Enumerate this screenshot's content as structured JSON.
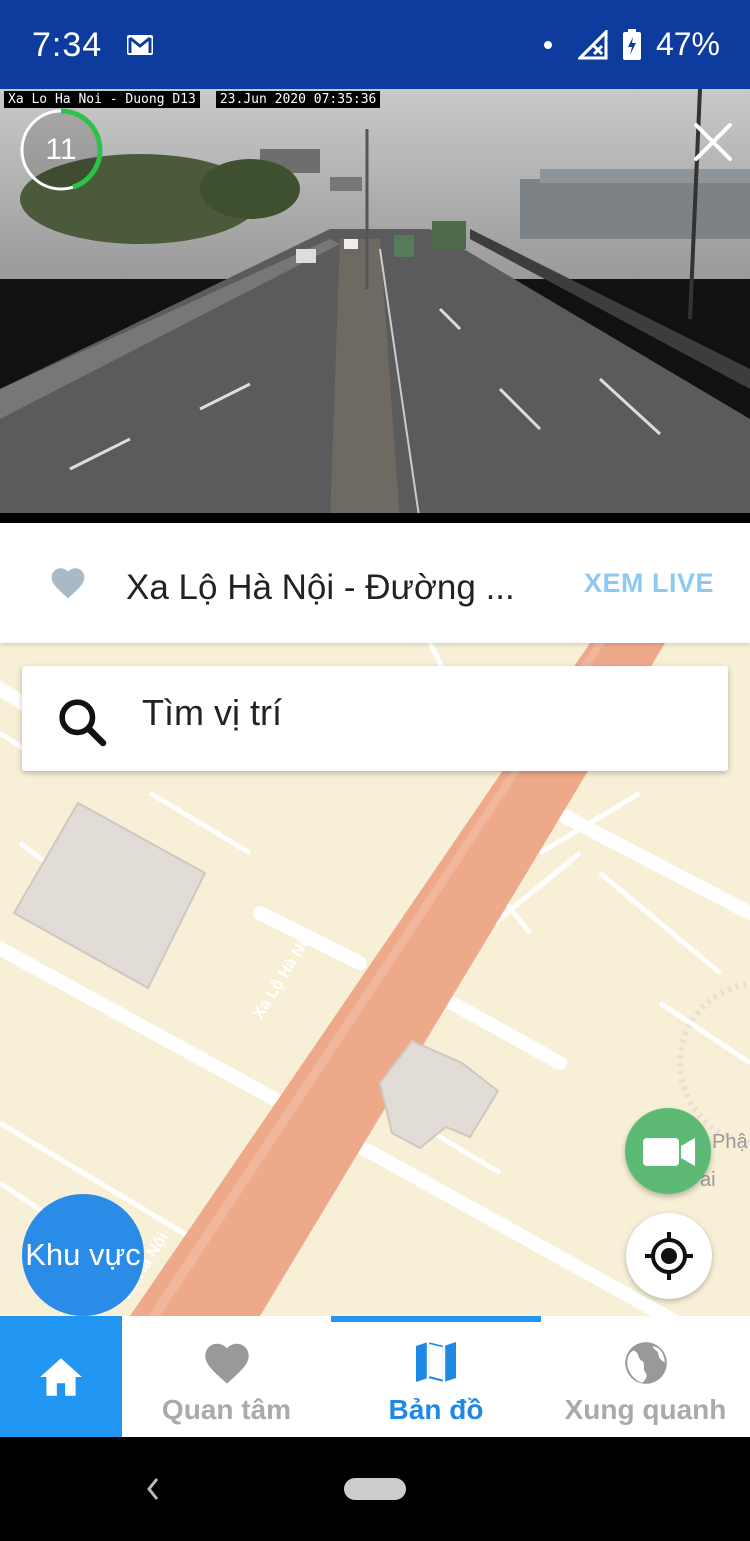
{
  "status_bar": {
    "time": "7:34",
    "battery": "47%",
    "icons": [
      "gmail-icon",
      "dot-icon",
      "signal-off-icon",
      "battery-charging-icon"
    ]
  },
  "camera": {
    "location_tag": "Xa Lo Ha Noi - Duong D13",
    "timestamp_tag": "23.Jun 2020  07:35:36",
    "countdown": "11",
    "countdown_progress": 0.45,
    "close_icon": "close-icon"
  },
  "info": {
    "title": "Xa Lộ Hà Nội - Đường ...",
    "action": "XEM LIVE",
    "favorite_icon": "heart-icon"
  },
  "search": {
    "placeholder": "Tìm vị trí",
    "icon": "search-icon"
  },
  "map": {
    "road_label": "Xa Lộ Hà Nội",
    "road_label_2": "Lộ Hà Nội",
    "poi_partial_1": "Phậ",
    "poi_partial_2": "ai"
  },
  "area_button": "Khu vực",
  "bottom_nav": {
    "items": [
      {
        "label": "",
        "icon": "home-icon"
      },
      {
        "label": "Quan tâm",
        "icon": "heart-icon"
      },
      {
        "label": "Bản đồ",
        "icon": "map-icon"
      },
      {
        "label": "Xung quanh",
        "icon": "globe-icon"
      }
    ],
    "active_index": 2
  },
  "colors": {
    "status_bar": "#0d3b9e",
    "accent": "#2196f3",
    "camera_fab": "#5cba74",
    "road": "#eea98a",
    "map_bg": "#f7efd6"
  }
}
